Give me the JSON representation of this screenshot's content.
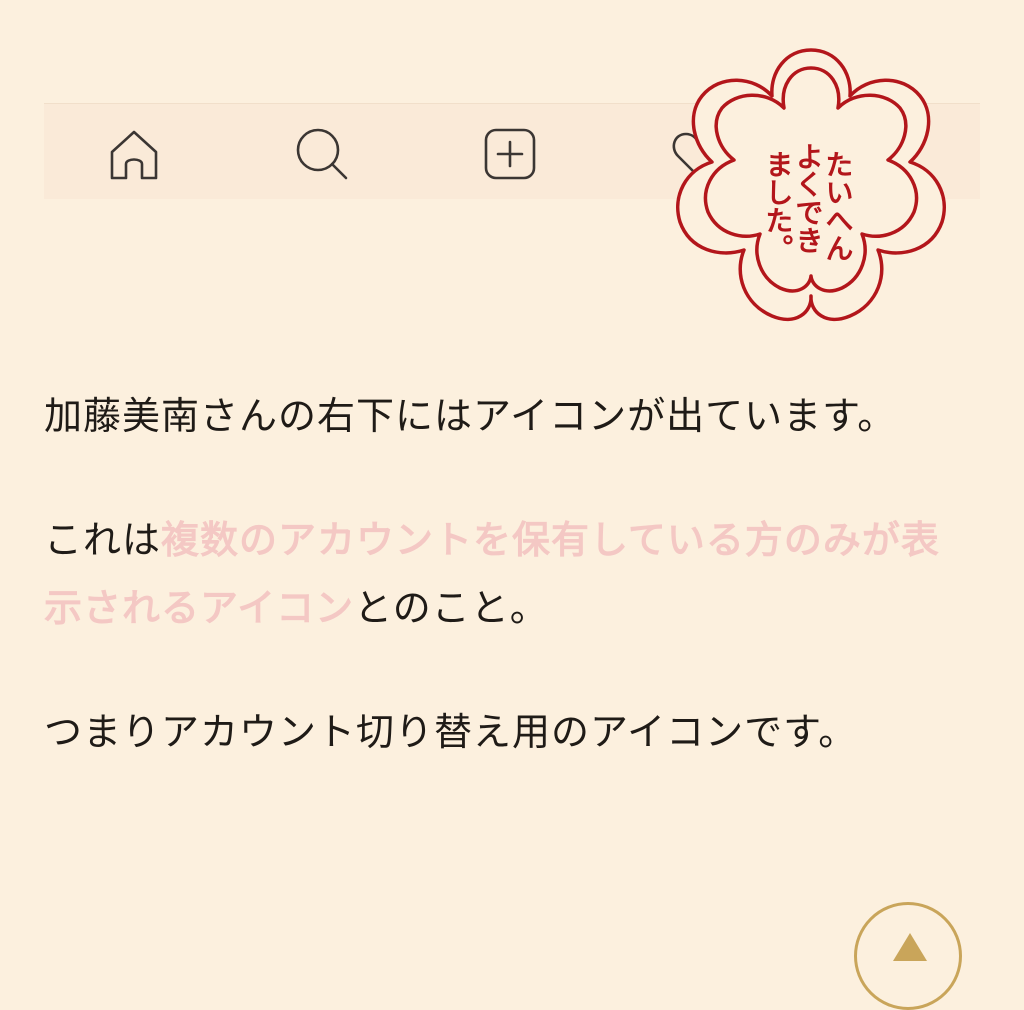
{
  "nav": {
    "icons": [
      "home-icon",
      "search-icon",
      "add-post-icon",
      "heart-icon",
      "profile-avatar"
    ]
  },
  "stamp": {
    "lines": [
      "たいへん",
      "よくでき",
      "ました。"
    ],
    "color": "#b3161b"
  },
  "article": {
    "paragraph1": "加藤美南さんの右下にはアイコンが出ています。",
    "paragraph2_before": "これは",
    "paragraph2_highlight": "複数のアカウントを保有している方のみが表示されるアイコン",
    "paragraph2_after": "とのこと。",
    "paragraph3": "つまりアカウント切り替え用のアイコンです。"
  },
  "colors": {
    "background": "#fcf0de",
    "highlight": "#f4c8c4",
    "text": "#1f1b17",
    "scroll_button": "#c9a55a"
  }
}
